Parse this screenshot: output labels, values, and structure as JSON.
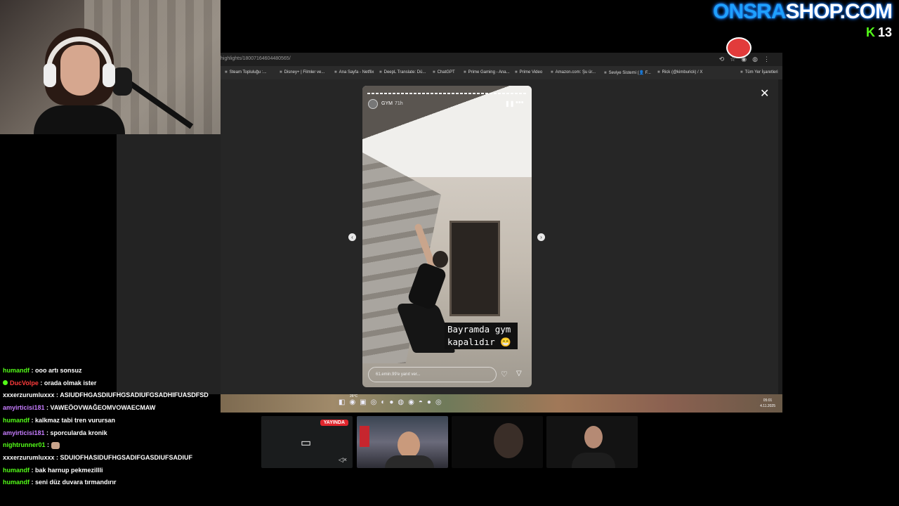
{
  "brand": {
    "text_a": "ONSRA",
    "text_b": "SHOP.COM"
  },
  "kick": {
    "logo": "K",
    "viewers": "13"
  },
  "browser": {
    "url": "highlights/18007164604480565/",
    "bookmarks": [
      "Steam Topluluğu :...",
      "Disney+ | Filmler ve...",
      "Ana Sayfa - Netflix",
      "DeepL Translate: Dü...",
      "ChatGPT",
      "Prime Gaming - Ana...",
      "Prime Video",
      "Amazon.com: Şu ür...",
      "Seviye Sistemi (👤 F...",
      "Rick (@kimburick) / X",
      "Tüm Yer İşaretleri"
    ],
    "close_glyph": "✕"
  },
  "story": {
    "username": "GYM",
    "time": "71h",
    "caption_line1": "Bayramda gym",
    "caption_line2": "kapalıdır 😁",
    "reply_placeholder": "61.emin.99'e yanıt ver..."
  },
  "taskbar": {
    "temp": "26°C",
    "time": "05:01",
    "date": "4.11.2025"
  },
  "cams": {
    "live_label": "YAYINDA"
  },
  "chat": [
    {
      "user": "humandf",
      "color": "#53fc18",
      "text": "ooo artı sonsuz"
    },
    {
      "user": "DucVolpe",
      "color": "#ff3b3b",
      "text": "orada olmak ister",
      "badge": true
    },
    {
      "user": "xxxerzurumluxxx",
      "color": "#ffffff",
      "text": "ASIUDFHGASDIUFHGSADIUFGSADHIFUASDFSD"
    },
    {
      "user": "amyirticisi181",
      "color": "#c77dff",
      "text": "VAWEÖOVWAĞEOMVOWAECMAW"
    },
    {
      "user": "humandf",
      "color": "#53fc18",
      "text": "kalkmaz tabi tren vurursan"
    },
    {
      "user": "amyirticisi181",
      "color": "#c77dff",
      "text": "sporcularda kronik"
    },
    {
      "user": "nightrunner01",
      "color": "#53fc18",
      "text": "",
      "emote": true
    },
    {
      "user": "xxxerzurumluxxx",
      "color": "#ffffff",
      "text": "SDUIOFHASIDUFHGSADIFGASDIUFSADIUF"
    },
    {
      "user": "humandf",
      "color": "#53fc18",
      "text": "bak harnup pekmezillli"
    },
    {
      "user": "humandf",
      "color": "#53fc18",
      "text": "seni düz duvara tırmandırır"
    }
  ]
}
